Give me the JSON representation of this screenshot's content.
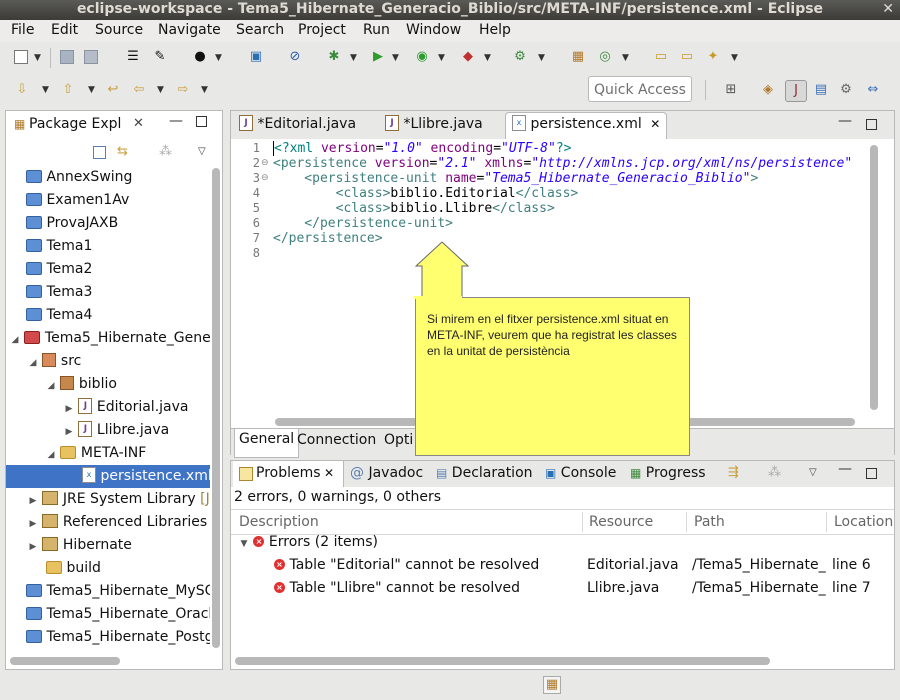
{
  "window": {
    "title": "eclipse-workspace - Tema5_Hibernate_Generacio_Biblio/src/META-INF/persistence.xml - Eclipse",
    "close_glyph": "✕"
  },
  "menubar": [
    "File",
    "Edit",
    "Source",
    "Navigate",
    "Search",
    "Project",
    "Run",
    "Window",
    "Help"
  ],
  "toolbar": {
    "quick_access": "Quick Access"
  },
  "package_explorer": {
    "title": "Package Expl",
    "items": [
      {
        "label": "AnnexSwing"
      },
      {
        "label": "Examen1Av"
      },
      {
        "label": "ProvaJAXB"
      },
      {
        "label": "Tema1"
      },
      {
        "label": "Tema2"
      },
      {
        "label": "Tema3"
      },
      {
        "label": "Tema4"
      },
      {
        "label": "Tema5_Hibernate_Gene"
      },
      {
        "label": "src"
      },
      {
        "label": "biblio"
      },
      {
        "label": "Editorial.java"
      },
      {
        "label": "Llibre.java"
      },
      {
        "label": "META-INF"
      },
      {
        "label": "persistence.xml"
      },
      {
        "label": "JRE System Library"
      },
      {
        "label": "[J"
      },
      {
        "label": "Referenced Libraries"
      },
      {
        "label": "Hibernate"
      },
      {
        "label": "build"
      },
      {
        "label": "Tema5_Hibernate_MySQ"
      },
      {
        "label": "Tema5_Hibernate_Oracl"
      },
      {
        "label": "Tema5_Hibernate_Postg"
      }
    ]
  },
  "editor": {
    "tabs": [
      {
        "label": "*Editorial.java"
      },
      {
        "label": "*Llibre.java"
      },
      {
        "label": "persistence.xml"
      }
    ],
    "line_numbers": [
      "1",
      "2",
      "3",
      "4",
      "5",
      "6",
      "7",
      "8"
    ],
    "code": {
      "l1_a": "<?xml ",
      "l1_b": "version",
      "l1_c": "=",
      "l1_d": "\"1.0\"",
      "l1_e": " encoding",
      "l1_f": "=",
      "l1_g": "\"UTF-8\"",
      "l1_h": "?>",
      "l2_a": "<persistence ",
      "l2_b": "version",
      "l2_c": "=",
      "l2_d": "\"2.1\"",
      "l2_e": " xmlns",
      "l2_f": "=",
      "l2_g": "\"http://xmlns.jcp.org/xml/ns/persistence\"",
      "l3_a": "    <persistence-unit ",
      "l3_b": "name",
      "l3_c": "=",
      "l3_d": "\"Tema5_Hibernate_Generacio_Biblio\"",
      "l3_e": ">",
      "l4_a": "        <class>",
      "l4_b": "biblio.Editorial",
      "l4_c": "</class>",
      "l5_a": "        <class>",
      "l5_b": "biblio.Llibre",
      "l5_c": "</class>",
      "l6_a": "    </persistence-unit>",
      "l7_a": "</persistence>"
    },
    "bottom_tabs": [
      "General",
      "Connection",
      "Opti"
    ]
  },
  "callout": {
    "text": "Si mirem en el fitxer persistence.xml situat en META-INF, veurem que ha registrat les classes en la unitat de persistència"
  },
  "problems": {
    "tabs": [
      "Problems",
      "Javadoc",
      "Declaration",
      "Console",
      "Progress"
    ],
    "summary": "2 errors, 0 warnings, 0 others",
    "columns": [
      "Description",
      "Resource",
      "Path",
      "Location"
    ],
    "group": "Errors (2 items)",
    "rows": [
      {
        "description": "Table \"Editorial\" cannot be resolved",
        "resource": "Editorial.java",
        "path": "/Tema5_Hibernate_",
        "location": "line 6"
      },
      {
        "description": "Table \"Llibre\" cannot be resolved",
        "resource": "Llibre.java",
        "path": "/Tema5_Hibernate_",
        "location": "line 7"
      }
    ]
  },
  "colors": {
    "selection": "#3f73c5",
    "callout_bg": "#ffff70",
    "title_bar": "#3c3b37"
  }
}
